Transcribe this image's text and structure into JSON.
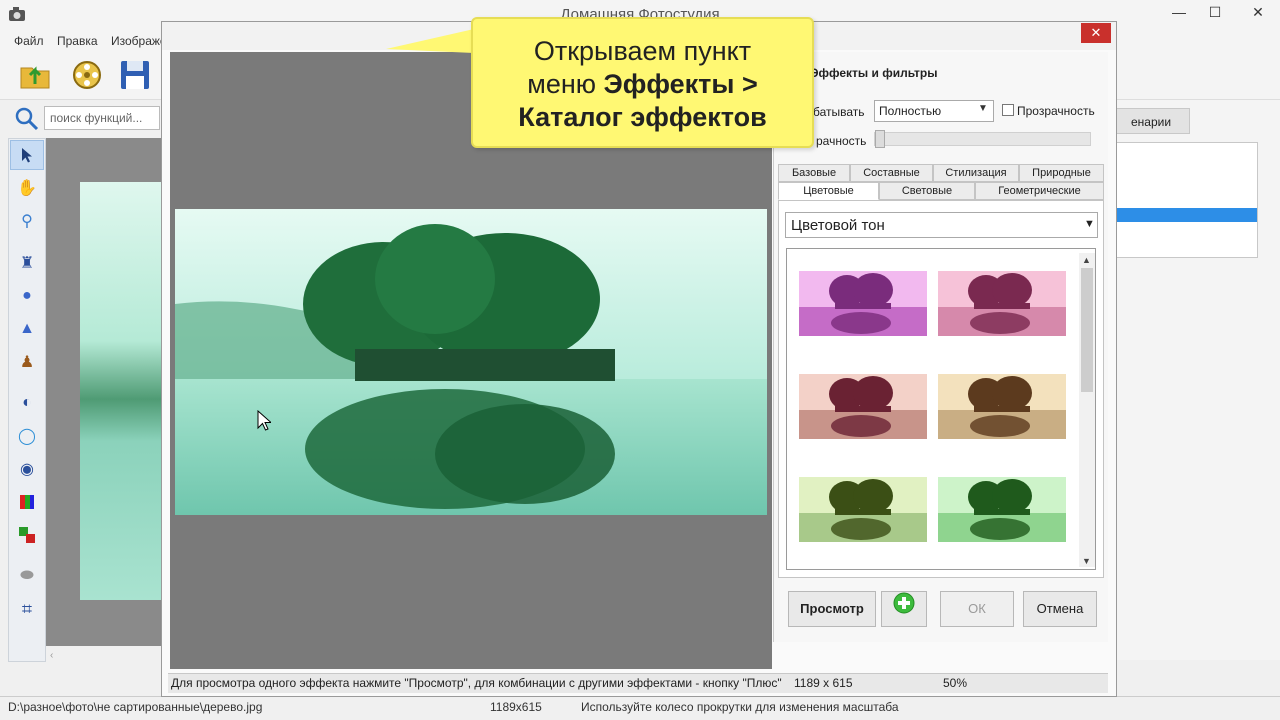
{
  "app": {
    "title": "Домашняя Фотостудия"
  },
  "menu": [
    "Файл",
    "Правка",
    "Изображение"
  ],
  "search": {
    "placeholder": "поиск функций..."
  },
  "right_panel": {
    "tab": "енарии"
  },
  "status": {
    "path": "D:\\разное\\фото\\не сартированные\\дерево.jpg",
    "size": "1189x615",
    "hint": "Используйте колесо прокрутки для изменения масштаба"
  },
  "dialog": {
    "close": "✕",
    "panel_title": "Эффекты и фильтры",
    "process_label": "батывать",
    "process_value": "Полностью",
    "transparency_label": "Прозрачность",
    "opacity_label": "рачность",
    "tabs_row1": [
      "Базовые",
      "Составные",
      "Стилизация",
      "Природные"
    ],
    "tabs_row2": [
      "Цветовые",
      "Световые",
      "Геометрические"
    ],
    "active_tab": "Цветовые",
    "category": "Цветовой тон",
    "buttons": {
      "preview": "Просмотр",
      "ok": "ОК",
      "cancel": "Отмена"
    },
    "status_hint": "Для просмотра одного эффекта нажмите \"Просмотр\", для комбинации с другими эффектами - кнопку \"Плюс\"",
    "status_size": "1189 x 615",
    "status_zoom": "50%"
  },
  "thumbnails": [
    {
      "name": "magenta",
      "sky": "#f2b9ef",
      "tree": "#7a2c7c",
      "water": "#c56cc7"
    },
    {
      "name": "pink",
      "sky": "#f6c2d8",
      "tree": "#7a2950",
      "water": "#d689ab"
    },
    {
      "name": "rose",
      "sky": "#f3d1c8",
      "tree": "#6a2233",
      "water": "#c8948a"
    },
    {
      "name": "sepia",
      "sky": "#f3e1bd",
      "tree": "#5c3a1e",
      "water": "#c9ae84"
    },
    {
      "name": "olive",
      "sky": "#e1f1c2",
      "tree": "#3b4f15",
      "water": "#a8c98a"
    },
    {
      "name": "green",
      "sky": "#cdf3c9",
      "tree": "#1f5a1c",
      "water": "#8fd48f"
    }
  ],
  "callout": {
    "line1": "Открываем пункт",
    "line2a": "меню ",
    "line2b": "Эффекты >",
    "line3": "Каталог эффектов"
  },
  "colors": {
    "accent": "#2d8ee7",
    "callout_bg": "#fff873",
    "close_red": "#c9302c"
  }
}
